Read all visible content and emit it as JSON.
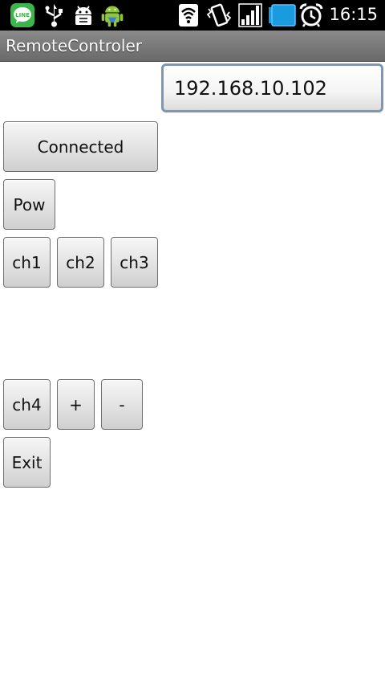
{
  "status_bar": {
    "time": "16:15",
    "line_icon_text": "LINE",
    "icons": [
      "line-app-icon",
      "usb-icon",
      "android-debug-icon",
      "android-mascot-icon",
      "wifi-icon",
      "vibrate-icon",
      "signal-icon",
      "battery-icon",
      "alarm-icon"
    ]
  },
  "app": {
    "title": "RemoteControler"
  },
  "ip_field": {
    "value": "192.168.10.102"
  },
  "buttons": {
    "connected": "Connected",
    "pow": "Pow",
    "ch1": "ch1",
    "ch2": "ch2",
    "ch3": "ch3",
    "ch4": "ch4",
    "plus": "+",
    "minus": "-",
    "exit": "Exit"
  },
  "colors": {
    "status_bar_bg": "#000000",
    "title_bar": "#7a7a7a",
    "focus_border": "#7b98b7",
    "battery": "#1a9be0",
    "line_green": "#3cb64a"
  }
}
